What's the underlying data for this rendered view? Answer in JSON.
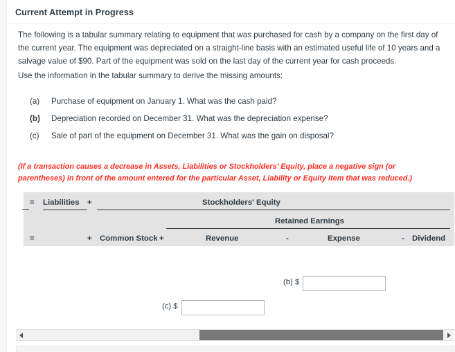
{
  "header": {
    "title": "Current Attempt in Progress"
  },
  "body": {
    "intro": "The following is a tabular summary relating to equipment that was purchased for cash by a company on the first day of the current year. The equipment was depreciated on a straight-line basis with an estimated useful life of 10 years and a salvage value of $90. Part of the equipment was sold on the last day of the current year for cash proceeds.",
    "instruction": "Use the information in the tabular summary to derive the missing amounts:",
    "questions": [
      {
        "label": "(a)",
        "text": "Purchase of equipment on January 1. What was the cash paid?",
        "bold": false
      },
      {
        "label": "(b)",
        "text": "Depreciation recorded on December 31. What was the depreciation expense?",
        "bold": true
      },
      {
        "label": "(c)",
        "text": "Sale of part of the equipment on December 31. What was the gain on disposal?",
        "bold": false
      }
    ],
    "note": "(If a transaction causes a decrease in Assets, Liabilities or Stockholders' Equity, place a negative sign (or parentheses) in front of the amount entered for the particular Asset, Liability or Equity item that was reduced.)"
  },
  "table": {
    "row1": {
      "eq": "=",
      "liabilities": "Liabilities",
      "plus": "+",
      "stockholders_equity": "Stockholders' Equity"
    },
    "row2": {
      "retained_earnings": "Retained Earnings"
    },
    "row3": {
      "eq": "=",
      "plus1": "+",
      "common_stock": "Common Stock",
      "plus2": "+",
      "revenue": "Revenue",
      "minus1": "-",
      "expense": "Expense",
      "minus2": "-",
      "dividend": "Dividend"
    }
  },
  "answers": {
    "b": {
      "label": "(b) $",
      "value": "",
      "placeholder": ""
    },
    "c": {
      "label": "(c) $",
      "value": "",
      "placeholder": ""
    }
  },
  "scrollbar": {
    "left_arrow": "◀",
    "right_arrow": "▶"
  },
  "colors": {
    "note_red": "#ff2d21",
    "header_band": "#e3e3e3",
    "scroll_thumb": "#787878",
    "text": "#2d3b45"
  }
}
